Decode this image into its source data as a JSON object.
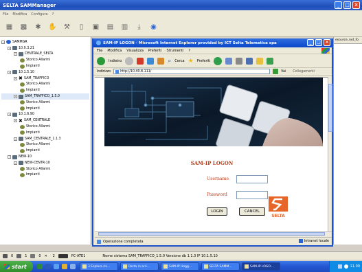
{
  "app": {
    "title": "SELTA SAMManager",
    "menu": [
      "File",
      "Modifica",
      "Configura",
      "?"
    ],
    "toolbar_icons": [
      "layers-icon",
      "layers-add-icon",
      "star-icon",
      "thumb-icon",
      "tools-icon",
      "window-icon",
      "monitor-icon",
      "server-icon",
      "document-icon",
      "download-icon",
      "globe-icon"
    ]
  },
  "tree": {
    "nodes": [
      {
        "label": "SAMMGR",
        "level": 0,
        "icon": "root",
        "exp": "-"
      },
      {
        "label": "10.0.3.21",
        "level": 1,
        "icon": "pc",
        "exp": "-"
      },
      {
        "label": "CENTRALE_SELTA",
        "level": 2,
        "icon": "pc",
        "exp": "-"
      },
      {
        "label": "Storico Allarmi",
        "level": 3,
        "icon": "hist"
      },
      {
        "label": "Impianti",
        "level": 3,
        "icon": "hist"
      },
      {
        "label": "10.1.5.10",
        "level": 1,
        "icon": "pc",
        "exp": "-"
      },
      {
        "label": "SAM_TRAFFICO",
        "level": 2,
        "icon": "x",
        "exp": "-"
      },
      {
        "label": "Storico Allarmi",
        "level": 3,
        "icon": "hist"
      },
      {
        "label": "Impianti",
        "level": 3,
        "icon": "hist"
      },
      {
        "label": "SAM_TRAFFICO_1.5.0",
        "level": 2,
        "icon": "pc",
        "exp": "-",
        "selected": true
      },
      {
        "label": "Storico Allarmi",
        "level": 3,
        "icon": "hist"
      },
      {
        "label": "Impianti",
        "level": 3,
        "icon": "hist"
      },
      {
        "label": "10.1.6.90",
        "level": 1,
        "icon": "pc",
        "exp": "-"
      },
      {
        "label": "SAM_CENTRALE",
        "level": 2,
        "icon": "x",
        "exp": "-"
      },
      {
        "label": "Storico Allarmi",
        "level": 3,
        "icon": "hist"
      },
      {
        "label": "Impianti",
        "level": 3,
        "icon": "hist"
      },
      {
        "label": "SAM_CENTRALE_1.1.3",
        "level": 2,
        "icon": "pc",
        "exp": "-"
      },
      {
        "label": "Storico Allarmi",
        "level": 3,
        "icon": "hist"
      },
      {
        "label": "Impianti",
        "level": 3,
        "icon": "hist"
      },
      {
        "label": "NEW-10",
        "level": 1,
        "icon": "pc",
        "exp": "-"
      },
      {
        "label": "NEW-CENTR-10",
        "level": 2,
        "icon": "pc",
        "exp": "-"
      },
      {
        "label": "Storico Allarmi",
        "level": 3,
        "icon": "hist"
      },
      {
        "label": "Impianti",
        "level": 3,
        "icon": "hist"
      }
    ]
  },
  "right_panel": {
    "header": "esource_not_fo"
  },
  "ie": {
    "title": "SAM-IP LOGON - Microsoft Internet Explorer provided by ICT Selta Telematica spa",
    "menu": [
      "File",
      "Modifica",
      "Visualizza",
      "Preferiti",
      "Strumenti",
      "?"
    ],
    "toolbar": {
      "back": "Indietro",
      "search": "Cerca",
      "favorites": "Preferiti"
    },
    "address_label": "Indirizzo",
    "address_value": "http://10.40.8.111/",
    "go_label": "Vai",
    "links_label": "Collegamenti",
    "status_text": "Operazione completata",
    "zone_text": "Intranet locale"
  },
  "login": {
    "heading": "SAM-IP LOGON",
    "username_label": "Username",
    "password_label": "Password",
    "login_button": "LOGIN",
    "cancel_button": "CANCEL",
    "logo_text": "SELTA",
    "username_value": "",
    "password_value": ""
  },
  "app_status": {
    "counters": [
      "0",
      "1",
      "0",
      "2"
    ],
    "host": "PC-ATE1",
    "message": "Nome sistema SAM_TRAFFICO_1.5.0 Versione db 1.1.3 IP 10.1.5.10"
  },
  "taskbar": {
    "start": "start",
    "tasks": [
      "3 Esplora ris...",
      "Posta in arri...",
      "SAM-IP Hogg...",
      "SELTA SAMM...",
      "SAM-IP LOGO..."
    ],
    "clock": "11.09"
  },
  "colors": {
    "accent": "#1c52c7",
    "login_red": "#b5411e",
    "selta_orange": "#e8652a"
  }
}
